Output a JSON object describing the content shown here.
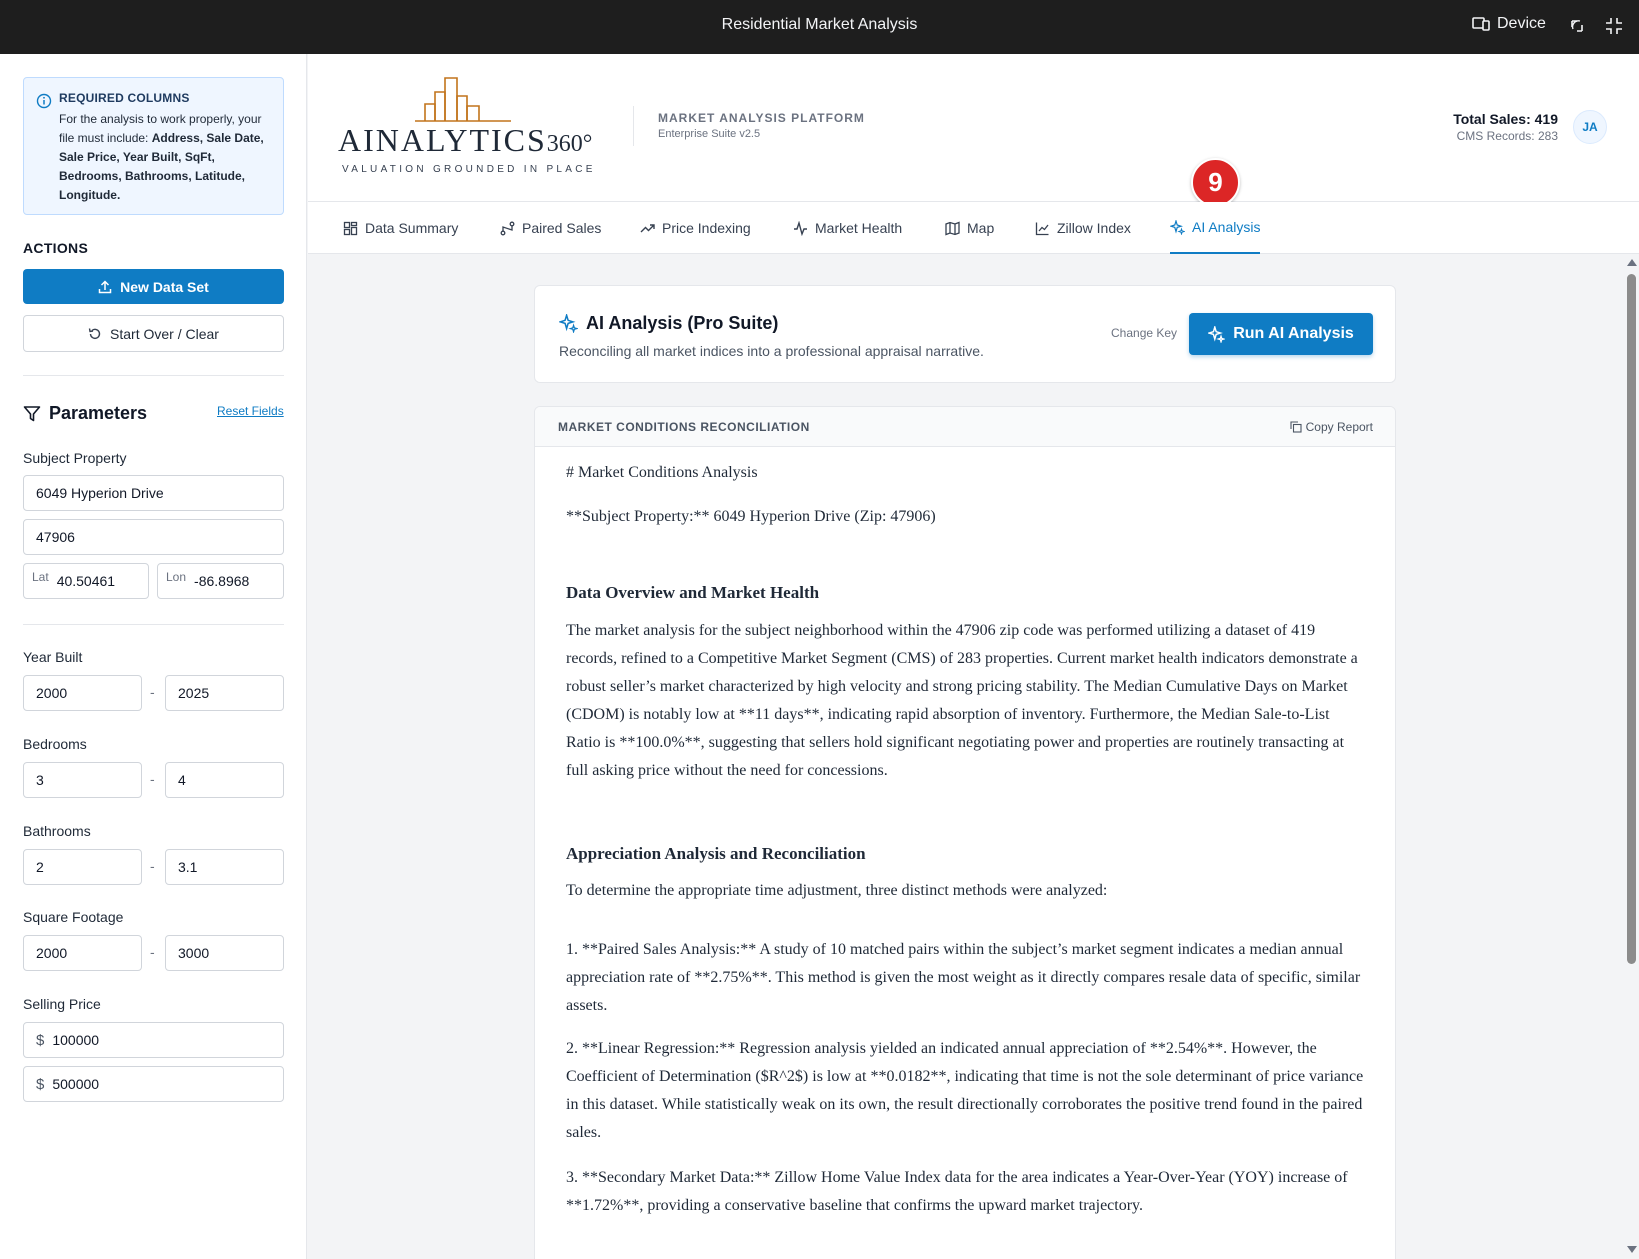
{
  "window": {
    "title": "Residential Market Analysis",
    "device_label": "Device"
  },
  "sidebar": {
    "required": {
      "title": "REQUIRED COLUMNS",
      "text_prefix": "For the analysis to work properly, your file must include: ",
      "columns": "Address, Sale Date, Sale Price, Year Built, SqFt, Bedrooms, Bathrooms, Latitude, Longitude."
    },
    "actions_title": "ACTIONS",
    "new_data_set": "New Data Set",
    "start_over": "Start Over / Clear",
    "parameters_title": "Parameters",
    "reset_fields": "Reset Fields",
    "subject_property_label": "Subject Property",
    "address": "6049 Hyperion Drive",
    "zip": "47906",
    "lat_label": "Lat",
    "lat": "40.50461",
    "lon_label": "Lon",
    "lon": "-86.8968",
    "year_built_label": "Year Built",
    "year_min": "2000",
    "year_max": "2025",
    "bedrooms_label": "Bedrooms",
    "bed_min": "3",
    "bed_max": "4",
    "bathrooms_label": "Bathrooms",
    "bath_min": "2",
    "bath_max": "3.1",
    "sqft_label": "Square Footage",
    "sqft_min": "2000",
    "sqft_max": "3000",
    "price_label": "Selling Price",
    "currency": "$",
    "price_min": "100000",
    "price_max": "500000",
    "range_sep": "-"
  },
  "header": {
    "brand": "AINALYTICS",
    "brand_suffix": "360°",
    "tagline": "VALUATION GROUNDED IN PLACE",
    "platform": "MARKET ANALYSIS PLATFORM",
    "platform_sub": "Enterprise Suite v2.5",
    "total_sales": "Total Sales: 419",
    "cms_records": "CMS Records: 283",
    "avatar": "JA",
    "badge": "9"
  },
  "tabs": [
    {
      "label": "Data Summary",
      "icon": "grid-icon"
    },
    {
      "label": "Paired Sales",
      "icon": "route-icon"
    },
    {
      "label": "Price Indexing",
      "icon": "trend-up-icon"
    },
    {
      "label": "Market Health",
      "icon": "pulse-icon"
    },
    {
      "label": "Map",
      "icon": "map-icon"
    },
    {
      "label": "Zillow Index",
      "icon": "line-chart-icon"
    },
    {
      "label": "AI Analysis",
      "icon": "sparkles-icon",
      "active": true
    }
  ],
  "ai_card": {
    "title": "AI Analysis (Pro Suite)",
    "subtitle": "Reconciling all market indices into a professional appraisal narrative.",
    "change_key": "Change Key",
    "run_button": "Run AI Analysis"
  },
  "report": {
    "header": "MARKET CONDITIONS RECONCILIATION",
    "copy": "Copy Report",
    "h1": "# Market Conditions Analysis",
    "subject": "**Subject Property:** 6049 Hyperion Drive (Zip: 47906)",
    "section1": "Data Overview and Market Health",
    "para1": "The market analysis for the subject neighborhood within the 47906 zip code was performed utilizing a dataset of 419 records, refined to a Competitive Market Segment (CMS) of 283 properties. Current market health indicators demonstrate a robust seller’s market characterized by high velocity and strong pricing stability. The Median Cumulative Days on Market (CDOM) is notably low at **11 days**, indicating rapid absorption of inventory. Furthermore, the Median Sale-to-List Ratio is **100.0%**, suggesting that sellers hold significant negotiating power and properties are routinely transacting at full asking price without the need for concessions.",
    "section2": "Appreciation Analysis and Reconciliation",
    "para2": "To determine the appropriate time adjustment, three distinct methods were analyzed:",
    "item1": "1. **Paired Sales Analysis:** A study of 10 matched pairs within the subject’s market segment indicates a median annual appreciation rate of **2.75%**. This method is given the most weight as it directly compares resale data of specific, similar assets.",
    "item2": "2. **Linear Regression:** Regression analysis yielded an indicated annual appreciation of **2.54%**. However, the Coefficient of Determination ($R^2$) is low at **0.0182**, indicating that time is not the sole determinant of price variance in this dataset. While statistically weak on its own, the result directionally corroborates the positive trend found in the paired sales.",
    "item3": "3. **Secondary Market Data:** Zillow Home Value Index data for the area indicates a Year-Over-Year (YOY) increase of **1.72%**, providing a conservative baseline that confirms the upward market trajectory."
  },
  "colors": {
    "accent": "#0f7cc4",
    "badge": "#dc2626",
    "chrome": "#1e1e1e"
  }
}
